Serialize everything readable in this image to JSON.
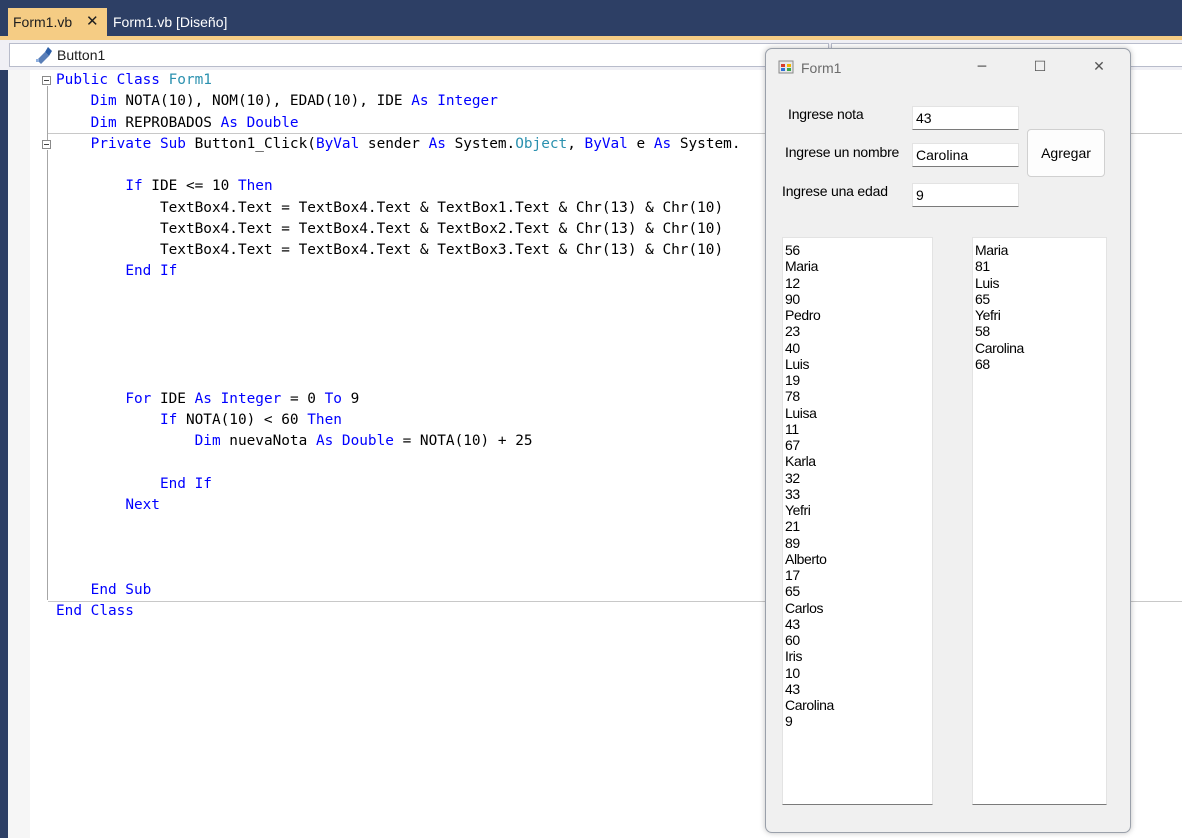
{
  "tabs": [
    {
      "label": "Form1.vb",
      "active": true
    },
    {
      "label": "Form1.vb [Diseño]",
      "active": false
    }
  ],
  "navbar": {
    "member": "Button1"
  },
  "code_lines": [
    [
      {
        "t": "Public Class ",
        "k": "kw"
      },
      {
        "t": "Form1",
        "k": "ty"
      }
    ],
    [
      {
        "t": "    "
      },
      {
        "t": "Dim",
        "k": "kw"
      },
      {
        "t": " NOTA(10), NOM(10), EDAD(10), IDE "
      },
      {
        "t": "As Integer",
        "k": "kw"
      }
    ],
    [
      {
        "t": "    "
      },
      {
        "t": "Dim",
        "k": "kw"
      },
      {
        "t": " REPROBADOS "
      },
      {
        "t": "As Double",
        "k": "kw"
      }
    ],
    [
      {
        "t": "    "
      },
      {
        "t": "Private Sub",
        "k": "kw"
      },
      {
        "t": " Button1_Click("
      },
      {
        "t": "ByVal",
        "k": "kw"
      },
      {
        "t": " sender "
      },
      {
        "t": "As",
        "k": "kw"
      },
      {
        "t": " System."
      },
      {
        "t": "Object",
        "k": "ty"
      },
      {
        "t": ", "
      },
      {
        "t": "ByVal",
        "k": "kw"
      },
      {
        "t": " e "
      },
      {
        "t": "As",
        "k": "kw"
      },
      {
        "t": " System."
      }
    ],
    [],
    [
      {
        "t": "        "
      },
      {
        "t": "If",
        "k": "kw"
      },
      {
        "t": " IDE <= 10 "
      },
      {
        "t": "Then",
        "k": "kw"
      }
    ],
    [
      {
        "t": "            TextBox4.Text = TextBox4.Text & TextBox1.Text & Chr(13) & Chr(10)"
      }
    ],
    [
      {
        "t": "            TextBox4.Text = TextBox4.Text & TextBox2.Text & Chr(13) & Chr(10)"
      }
    ],
    [
      {
        "t": "            TextBox4.Text = TextBox4.Text & TextBox3.Text & Chr(13) & Chr(10)"
      }
    ],
    [
      {
        "t": "        "
      },
      {
        "t": "End If",
        "k": "kw"
      }
    ],
    [],
    [],
    [],
    [],
    [],
    [
      {
        "t": "        "
      },
      {
        "t": "For",
        "k": "kw"
      },
      {
        "t": " IDE "
      },
      {
        "t": "As Integer",
        "k": "kw"
      },
      {
        "t": " = 0 "
      },
      {
        "t": "To",
        "k": "kw"
      },
      {
        "t": " 9"
      }
    ],
    [
      {
        "t": "            "
      },
      {
        "t": "If",
        "k": "kw"
      },
      {
        "t": " NOTA(10) < 60 "
      },
      {
        "t": "Then",
        "k": "kw"
      }
    ],
    [
      {
        "t": "                "
      },
      {
        "t": "Dim",
        "k": "kw"
      },
      {
        "t": " nuevaNota "
      },
      {
        "t": "As Double",
        "k": "kw"
      },
      {
        "t": " = NOTA(10) + 25"
      }
    ],
    [],
    [
      {
        "t": "            "
      },
      {
        "t": "End If",
        "k": "kw"
      }
    ],
    [
      {
        "t": "        "
      },
      {
        "t": "Next",
        "k": "kw"
      }
    ],
    [],
    [],
    [],
    [
      {
        "t": "    "
      },
      {
        "t": "End Sub",
        "k": "kw"
      }
    ],
    [
      {
        "t": "End Class",
        "k": "kw"
      }
    ]
  ],
  "form": {
    "title": "Form1",
    "label_nota": "Ingrese nota",
    "label_nombre": "Ingrese un nombre",
    "label_edad": "Ingrese una edad",
    "nota_value": "43",
    "nombre_value": "Carolina",
    "edad_value": "9",
    "button_label": "Agregar",
    "list_left": [
      "56",
      "Maria",
      "12",
      "90",
      "Pedro",
      "23",
      "40",
      "Luis",
      "19",
      "78",
      "Luisa",
      "11",
      "67",
      "Karla",
      "32",
      "33",
      "Yefri",
      "21",
      "89",
      "Alberto",
      "17",
      "65",
      "Carlos",
      "43",
      "60",
      "Iris",
      "10",
      "43",
      "Carolina",
      "9"
    ],
    "list_right": [
      "Maria",
      "81",
      "Luis",
      "65",
      "Yefri",
      "58",
      "Carolina",
      "68"
    ]
  },
  "colors": {
    "keyword": "#0000ff",
    "type": "#2b91af",
    "tab_active": "#f5cc84",
    "chrome": "#2d3f65"
  }
}
